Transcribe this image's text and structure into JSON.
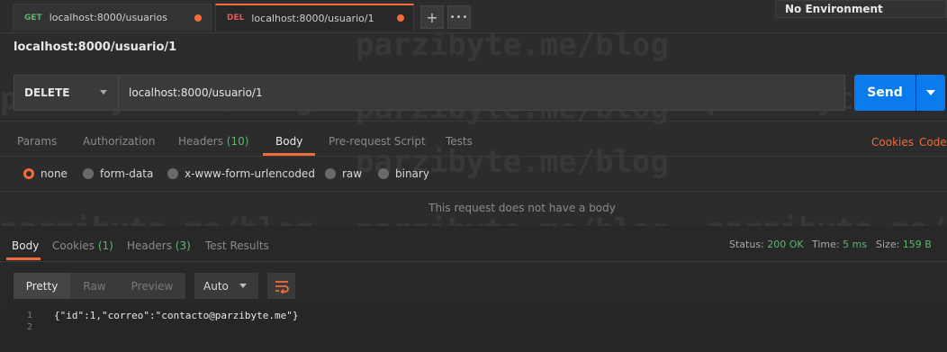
{
  "tabs": [
    {
      "method": "GET",
      "label": "localhost:8000/usuarios"
    },
    {
      "method": "DEL",
      "label": "localhost:8000/usuario/1"
    }
  ],
  "tab_actions": {
    "new_tab": "+",
    "more": "•••"
  },
  "environment": {
    "label": "No Environment"
  },
  "request": {
    "title": "localhost:8000/usuario/1",
    "method": "DELETE",
    "url": "localhost:8000/usuario/1",
    "send_label": "Send"
  },
  "request_tabs": {
    "params": "Params",
    "authorization": "Authorization",
    "headers": "Headers",
    "headers_count": "(10)",
    "body": "Body",
    "prerequest": "Pre-request Script",
    "tests": "Tests",
    "cookies": "Cookies",
    "code": "Code"
  },
  "body_types": {
    "none": "none",
    "form_data": "form-data",
    "urlencoded": "x-www-form-urlencoded",
    "raw": "raw",
    "binary": "binary",
    "selected": "none"
  },
  "no_body_message": "This request does not have a body",
  "response": {
    "tabs": {
      "body": "Body",
      "cookies": "Cookies",
      "cookies_count": "(1)",
      "headers": "Headers",
      "headers_count": "(3)",
      "test_results": "Test Results"
    },
    "status_label": "Status:",
    "status_value": "200 OK",
    "time_label": "Time:",
    "time_value": "5 ms",
    "size_label": "Size:",
    "size_value": "159 B",
    "views": {
      "pretty": "Pretty",
      "raw": "Raw",
      "preview": "Preview"
    },
    "format": "Auto",
    "lines": [
      {
        "no": "1",
        "text": "{\"id\":1,\"correo\":\"contacto@parzibyte.me\"}"
      },
      {
        "no": "2",
        "text": ""
      }
    ]
  },
  "watermark": "parzibyte.me/blog",
  "colors": {
    "accent": "#f26b3a",
    "send": "#097bed",
    "ok": "#59b86c",
    "del": "#e25a5a"
  }
}
